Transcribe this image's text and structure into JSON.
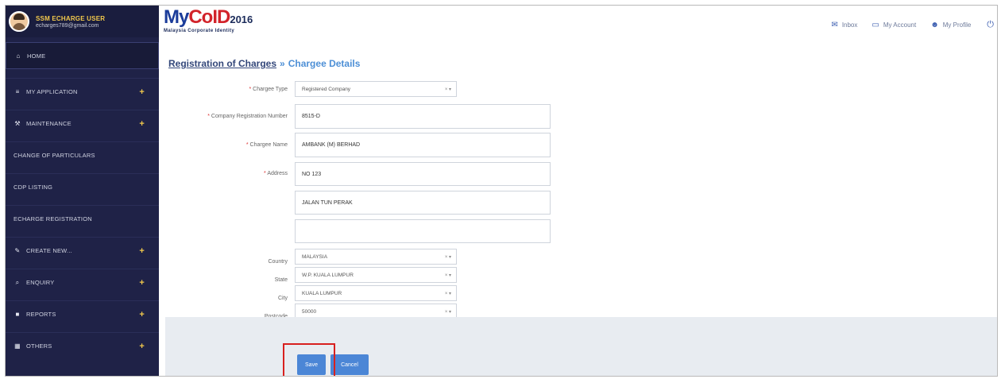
{
  "user": {
    "name": "SSM ECHARGE USER",
    "email": "echarges789@gmail.com"
  },
  "sidebar": {
    "items": [
      {
        "label": "HOME",
        "icon": "home-icon",
        "glyph": "⌂",
        "plus": ""
      },
      {
        "label": "MY APPLICATION",
        "icon": "list-icon",
        "glyph": "≡",
        "plus": "+"
      },
      {
        "label": "MAINTENANCE",
        "icon": "wrench-icon",
        "glyph": "⚒",
        "plus": "+"
      },
      {
        "label": "CHANGE OF PARTICULARS",
        "icon": "",
        "glyph": "",
        "plus": ""
      },
      {
        "label": "CDP LISTING",
        "icon": "",
        "glyph": "",
        "plus": ""
      },
      {
        "label": "ECHARGE REGISTRATION",
        "icon": "",
        "glyph": "",
        "plus": ""
      },
      {
        "label": "CREATE NEW...",
        "icon": "edit-icon",
        "glyph": "✎",
        "plus": "+"
      },
      {
        "label": "ENQUIRY",
        "icon": "search-icon",
        "glyph": "⌕",
        "plus": "+"
      },
      {
        "label": "REPORTS",
        "icon": "file-icon",
        "glyph": "■",
        "plus": "+"
      },
      {
        "label": "OTHERS",
        "icon": "calendar-icon",
        "glyph": "▦",
        "plus": "+"
      }
    ]
  },
  "header": {
    "logo_part1": "My",
    "logo_part2": "CoID",
    "logo_year": "2016",
    "logo_subtitle": "Malaysia Corporate Identity",
    "nav": [
      {
        "label": "Inbox",
        "icon": "envelope-icon",
        "glyph": "✉"
      },
      {
        "label": "My Account",
        "icon": "credit-card-icon",
        "glyph": "▭"
      },
      {
        "label": "My Profile",
        "icon": "user-icon",
        "glyph": "☻"
      }
    ],
    "power_icon": "power-icon"
  },
  "breadcrumb": {
    "parent": "Registration of Charges",
    "separator": "»",
    "current": "Chargee Details"
  },
  "form": {
    "chargee_type": {
      "label": "Chargee Type",
      "value": "Registered Company"
    },
    "company_reg_no": {
      "label": "Company Registration Number",
      "value": "8515-D"
    },
    "chargee_name": {
      "label": "Chargee Name",
      "value": "AMBANK (M) BERHAD"
    },
    "address": {
      "label": "Address",
      "line1": "NO 123",
      "line2": "JALAN TUN PERAK",
      "line3": ""
    },
    "country": {
      "label": "Country",
      "value": "MALAYSIA"
    },
    "state": {
      "label": "State",
      "value": "W.P. KUALA LUMPUR"
    },
    "city": {
      "label": "City",
      "value": "KUALA LUMPUR"
    },
    "postcode": {
      "label": "Postcode",
      "value": "50000"
    },
    "select_arrows": "× ▾",
    "required_mark": "*"
  },
  "buttons": {
    "save": "Save",
    "cancel": "Cancel"
  },
  "colors": {
    "sidebar_bg": "#1f2247",
    "accent_blue": "#4b86d6",
    "user_name": "#f2c94c",
    "highlight": "#d8201f"
  }
}
